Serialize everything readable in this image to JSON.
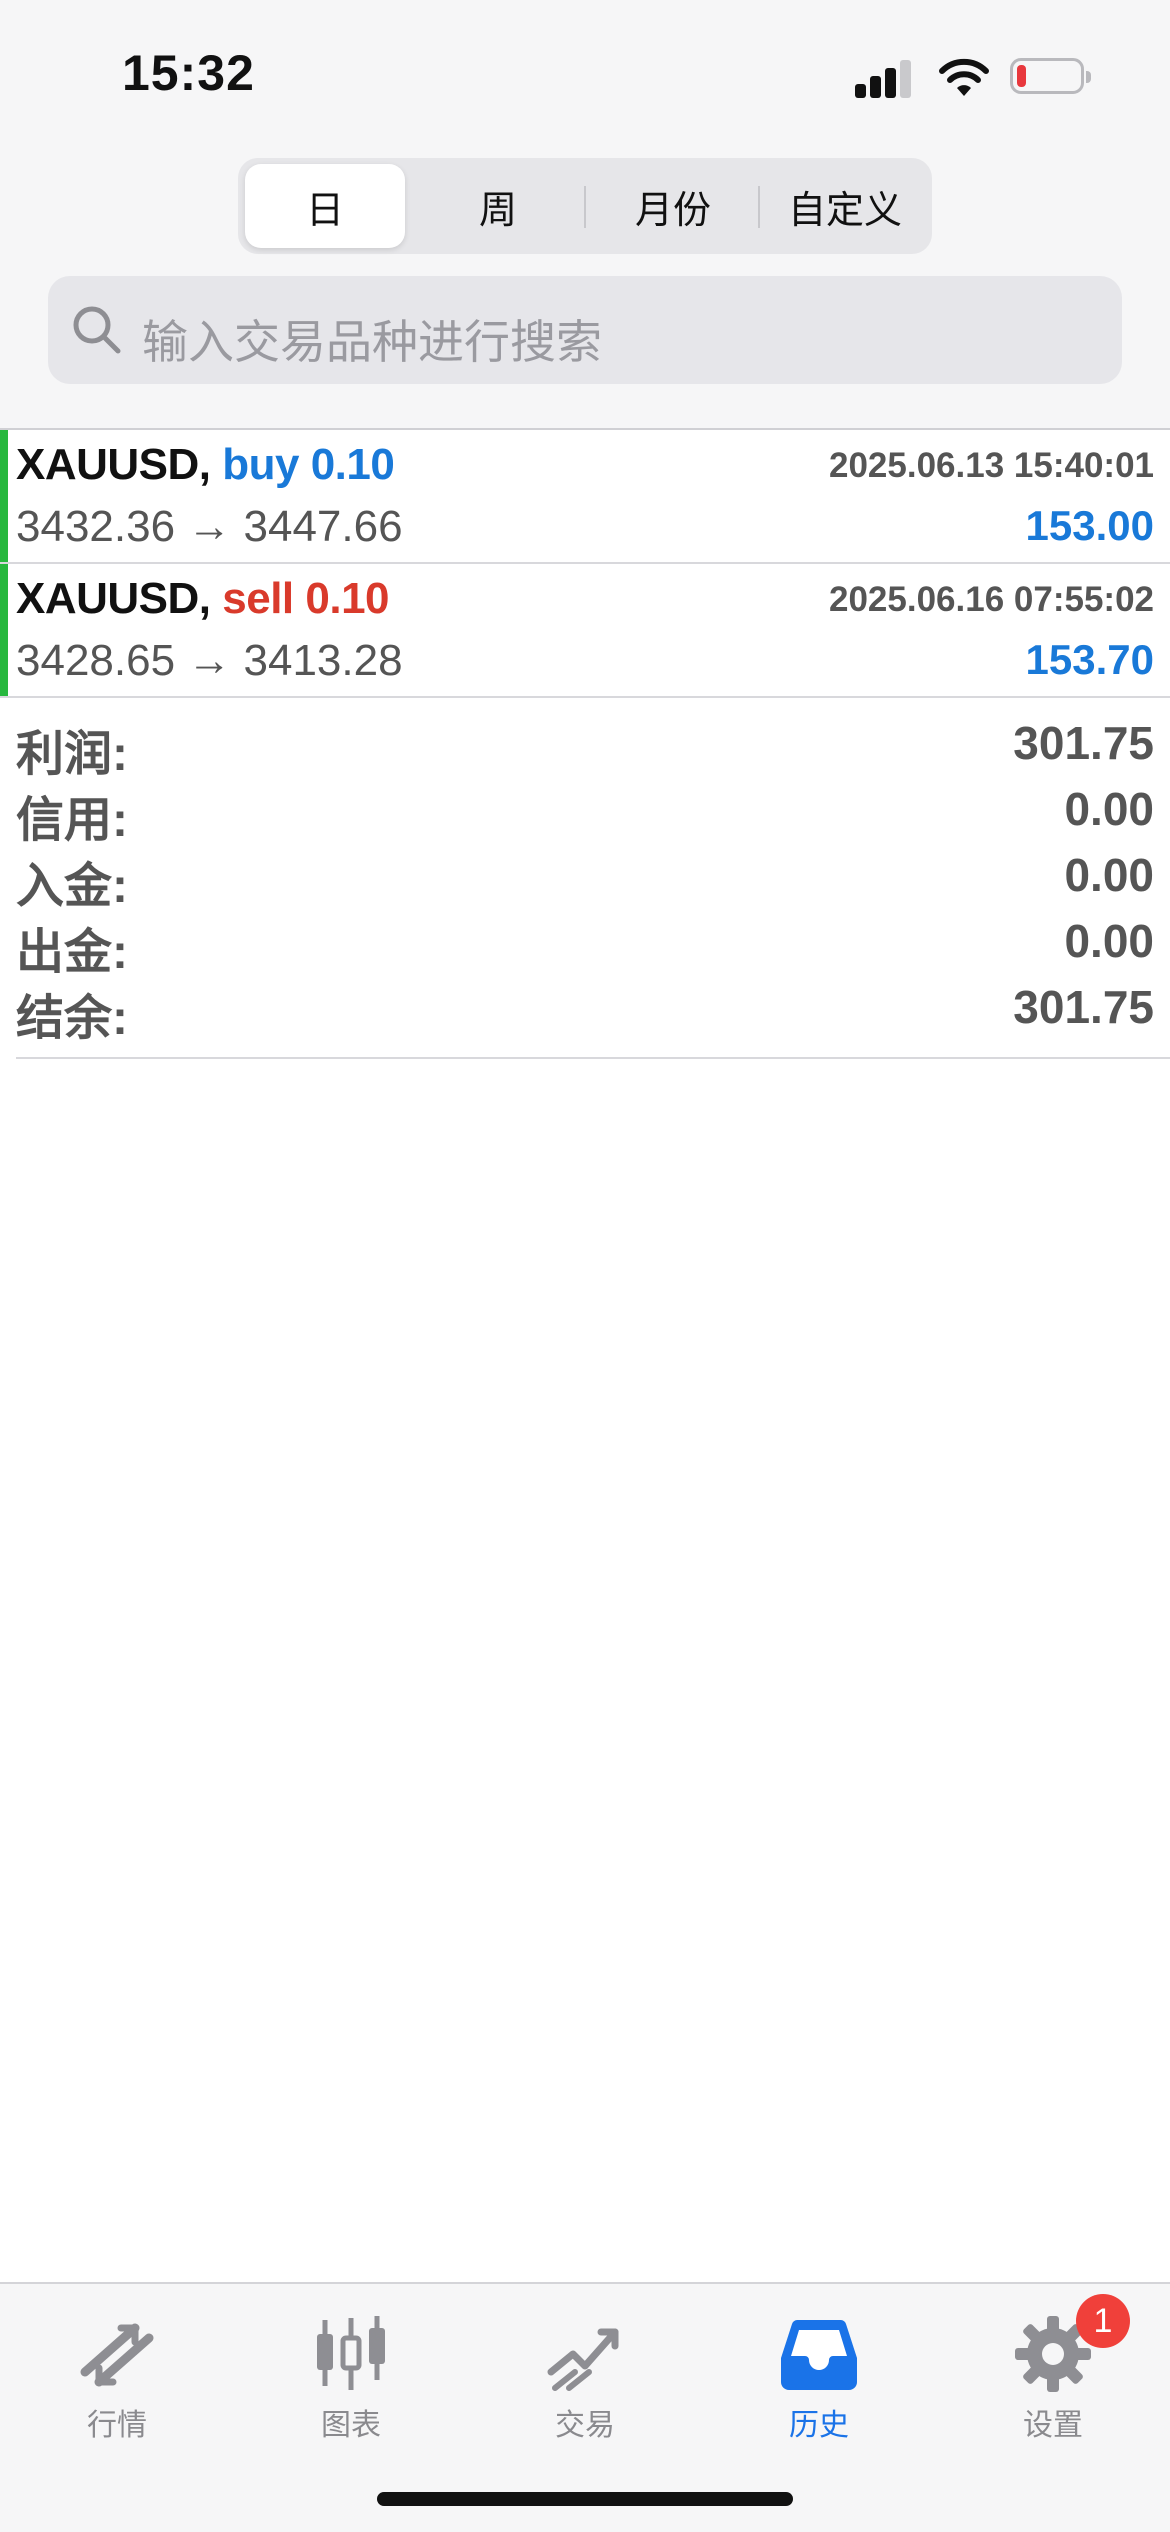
{
  "status_bar": {
    "time": "15:32"
  },
  "period_tabs": [
    {
      "label": "日",
      "active": true
    },
    {
      "label": "周",
      "active": false
    },
    {
      "label": "月份",
      "active": false
    },
    {
      "label": "自定义",
      "active": false
    }
  ],
  "search": {
    "placeholder": "输入交易品种进行搜索"
  },
  "trades": [
    {
      "symbol": "XAUUSD,",
      "side_label": "buy 0.10",
      "side_color": "#1979d8",
      "time": "2025.06.13 15:40:01",
      "prices": "3432.36 → 3447.66",
      "profit": "153.00"
    },
    {
      "symbol": "XAUUSD,",
      "side_label": "sell 0.10",
      "side_color": "#d93a2b",
      "time": "2025.06.16 07:55:02",
      "prices": "3428.65 → 3413.28",
      "profit": "153.70"
    }
  ],
  "summary": [
    {
      "label": "利润:",
      "value": "301.75"
    },
    {
      "label": "信用:",
      "value": "0.00"
    },
    {
      "label": "入金:",
      "value": "0.00"
    },
    {
      "label": "出金:",
      "value": "0.00"
    },
    {
      "label": "结余:",
      "value": "301.75"
    }
  ],
  "tabbar": {
    "items": [
      {
        "label": "行情",
        "icon": "quotes-icon"
      },
      {
        "label": "图表",
        "icon": "chart-icon"
      },
      {
        "label": "交易",
        "icon": "trade-icon"
      },
      {
        "label": "历史",
        "icon": "history-icon",
        "active": true
      },
      {
        "label": "设置",
        "icon": "settings-icon",
        "badge": "1"
      }
    ]
  },
  "colors": {
    "accent": "#1a73e8",
    "trade_bar": "#27b83e",
    "profit": "#1979d8",
    "buy": "#1979d8",
    "sell": "#d93a2b",
    "badge": "#f0403a"
  }
}
